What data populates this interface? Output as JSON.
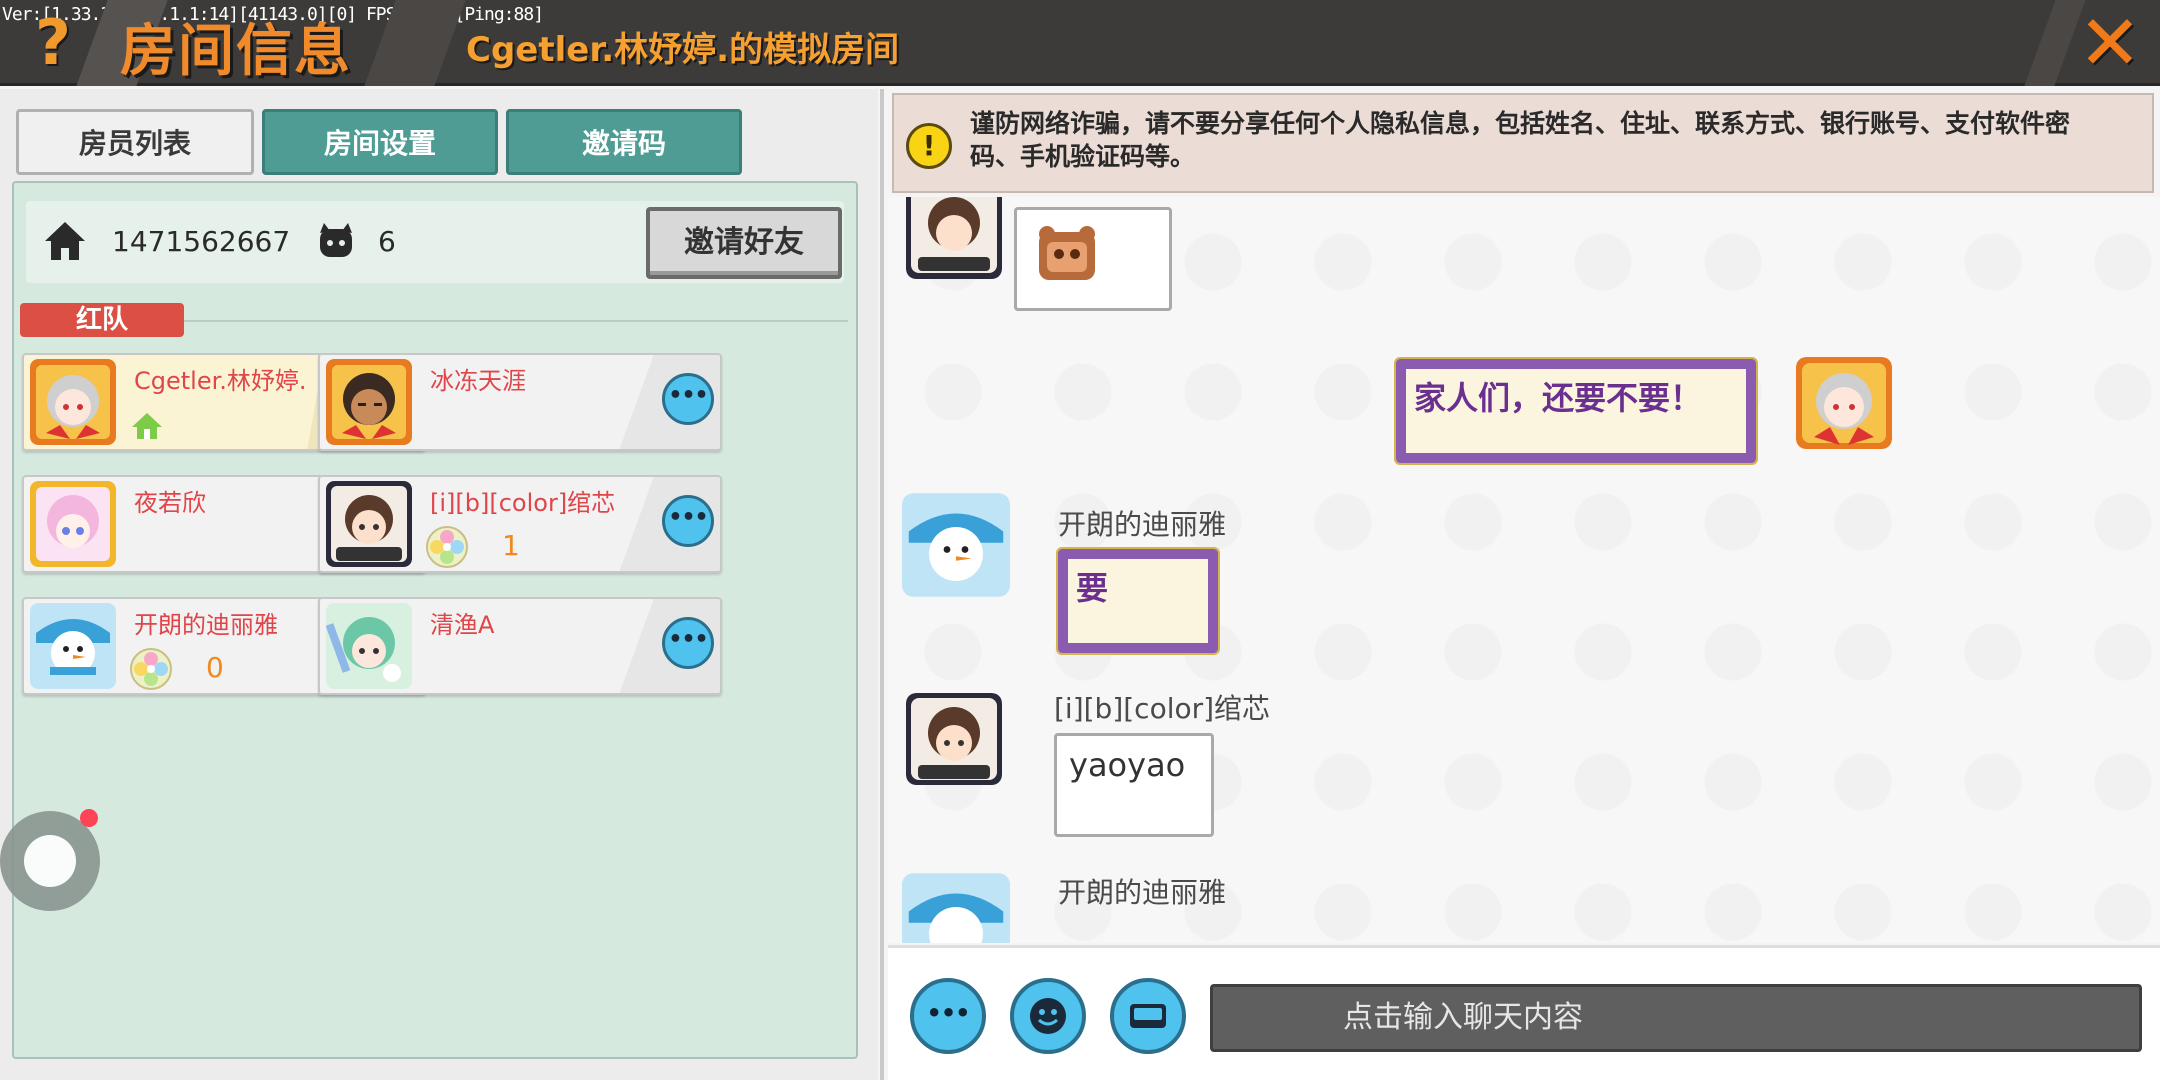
{
  "debug_text": "Ver:[1.33.3][4.9.1.1:14][41143.0][0] FPS: 15.7[Ping:88]",
  "header": {
    "help_label": "?",
    "title": "房间信息",
    "room_name": "Cgetler.林妤婷.的模拟房间",
    "close_label": "✕"
  },
  "tabs": [
    {
      "label": "房员列表",
      "active": true
    },
    {
      "label": "房间设置",
      "active": false
    },
    {
      "label": "邀请码",
      "active": false
    }
  ],
  "room": {
    "home_icon": "home-icon",
    "room_id": "1471562667",
    "players_icon": "people-icon",
    "player_count": "6",
    "invite_friends_label": "邀请好友"
  },
  "team": {
    "label": "红队",
    "color": "#dc4f45"
  },
  "members": [
    {
      "name": "Cgetler.林妤婷.",
      "host": true,
      "badge": "",
      "score": ""
    },
    {
      "name": "冰冻天涯",
      "host": false,
      "badge": "",
      "score": ""
    },
    {
      "name": "夜若欣",
      "host": false,
      "badge": "",
      "score": ""
    },
    {
      "name": "[i][b][color]绾芯",
      "host": false,
      "badge": "flower-badge-icon",
      "score": "1"
    },
    {
      "name": "开朗的迪丽雅",
      "host": false,
      "badge": "flower-badge-icon",
      "score": "0"
    },
    {
      "name": "清渔A",
      "host": false,
      "badge": "",
      "score": ""
    }
  ],
  "more_label": "•••",
  "warning": {
    "icon": "warning-icon",
    "text": "谨防网络诈骗，请不要分享任何个人隐私信息，包括姓名、住址、联系方式、银行账号、支付软件密码、手机验证码等。"
  },
  "chat": {
    "messages": [
      {
        "sender": "",
        "text": "",
        "type": "emoji",
        "emoji": "bear-face-emoji"
      },
      {
        "sender": "Cgetler.林妤婷.",
        "text": "家人们，还要不要！",
        "type": "self"
      },
      {
        "sender": "开朗的迪丽雅",
        "text": "要",
        "type": "other-purple"
      },
      {
        "sender": "[i][b][color]绾芯",
        "text": "yaoyao",
        "type": "other"
      },
      {
        "sender": "开朗的迪丽雅",
        "text": "",
        "type": "other-partial"
      }
    ],
    "input_placeholder": "点击输入聊天内容",
    "buttons": {
      "more": "•••",
      "emoji": "emoji-icon",
      "keyboard": "keyboard-icon"
    }
  },
  "colors": {
    "accent_orange": "#f08a2a",
    "teal_tab": "#4f9c95",
    "member_name": "#e0454a",
    "round_button": "#4fc2ee"
  }
}
